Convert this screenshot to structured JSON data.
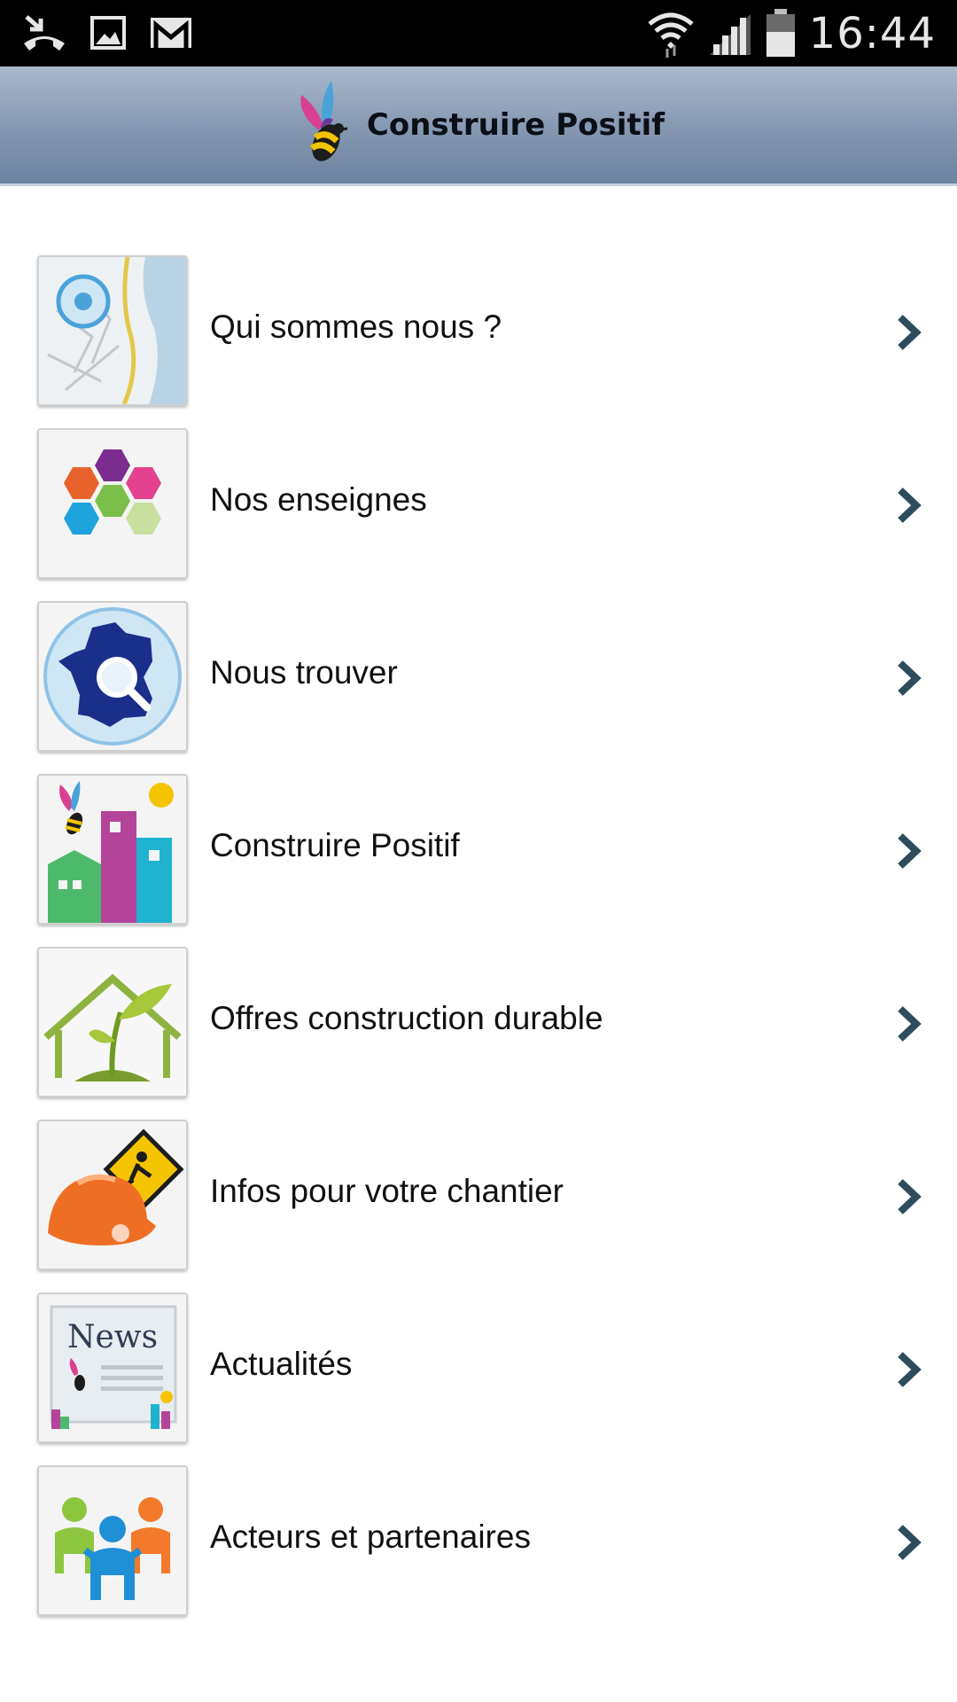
{
  "status_bar": {
    "left_icons": [
      "missed-call-icon",
      "image-icon",
      "gmail-icon"
    ],
    "right_icons": [
      "wifi-icon",
      "signal-icon",
      "battery-icon"
    ],
    "time": "16:44"
  },
  "header": {
    "logo_icon": "bee-logo-icon",
    "title": "Construire Positif",
    "gradient": [
      "#aab8cb",
      "#6d829f"
    ]
  },
  "menu": {
    "chevron_color": "#2d4c5c",
    "items": [
      {
        "label": "Qui sommes nous ?",
        "icon": "map-icon"
      },
      {
        "label": "Nos enseignes",
        "icon": "hexagons-icon"
      },
      {
        "label": "Nous trouver",
        "icon": "france-search-icon"
      },
      {
        "label": "Construire Positif",
        "icon": "buildings-icon"
      },
      {
        "label": "Offres construction durable",
        "icon": "eco-house-icon"
      },
      {
        "label": "Infos pour votre chantier",
        "icon": "construction-helmet-icon"
      },
      {
        "label": "Actualités",
        "icon": "news-icon",
        "icon_text": "News"
      },
      {
        "label": "Acteurs et partenaires",
        "icon": "people-icon"
      }
    ]
  }
}
